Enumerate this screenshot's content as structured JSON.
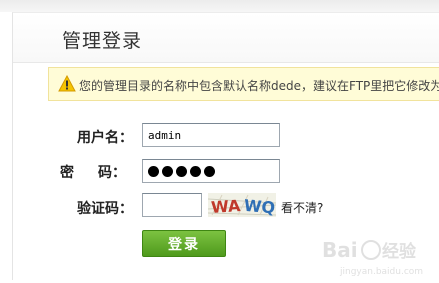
{
  "page": {
    "title": "管理登录"
  },
  "warning": {
    "icon": "warning-icon",
    "text": "您的管理目录的名称中包含默认名称dede，建议在FTP里把它修改为其"
  },
  "form": {
    "username_label": "用户名：",
    "username_value": "admin",
    "password_label_first": "密",
    "password_label_second": "码：",
    "password_masked_length": 5,
    "captcha_label": "验证码：",
    "captcha_value": "",
    "captcha_image_text": "WAWQ",
    "captcha_refresh_link": "看不清?",
    "login_button": "登录"
  },
  "watermark": {
    "brand": "Baidu",
    "brand_cn": "经验",
    "url": "jingyan.baidu.com"
  },
  "colors": {
    "warning_bg": "#fffcd7",
    "warning_border": "#f1e39c",
    "login_green": "#5ea82a",
    "captcha_red": "#c0392b",
    "captcha_blue": "#2f6fb5"
  }
}
